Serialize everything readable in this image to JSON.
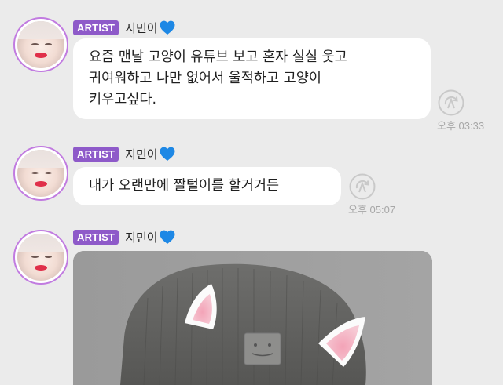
{
  "messages": [
    {
      "badge": "ARTIST",
      "name": "지민이",
      "text_lines": [
        "요즘 맨날 고양이 유튜브 보고 혼자 실실 웃고",
        "귀여워하고 나만 없어서 울적하고 고양이",
        "키우고싶다."
      ],
      "time": "오후 03:33"
    },
    {
      "badge": "ARTIST",
      "name": "지민이",
      "text_lines": [
        "내가 오랜만에 짤털이를 할거거든"
      ],
      "time": "오후 05:07"
    },
    {
      "badge": "ARTIST",
      "name": "지민이",
      "attachment": "photo"
    }
  ],
  "icons": {
    "heart": "blue-heart-icon",
    "record": "chat-record-icon"
  },
  "colors": {
    "background": "#ebebeb",
    "badge": "#8e5ac9",
    "avatar_ring": "#c17be0",
    "heart": "#1e88e5",
    "time": "#a7a7a7"
  }
}
